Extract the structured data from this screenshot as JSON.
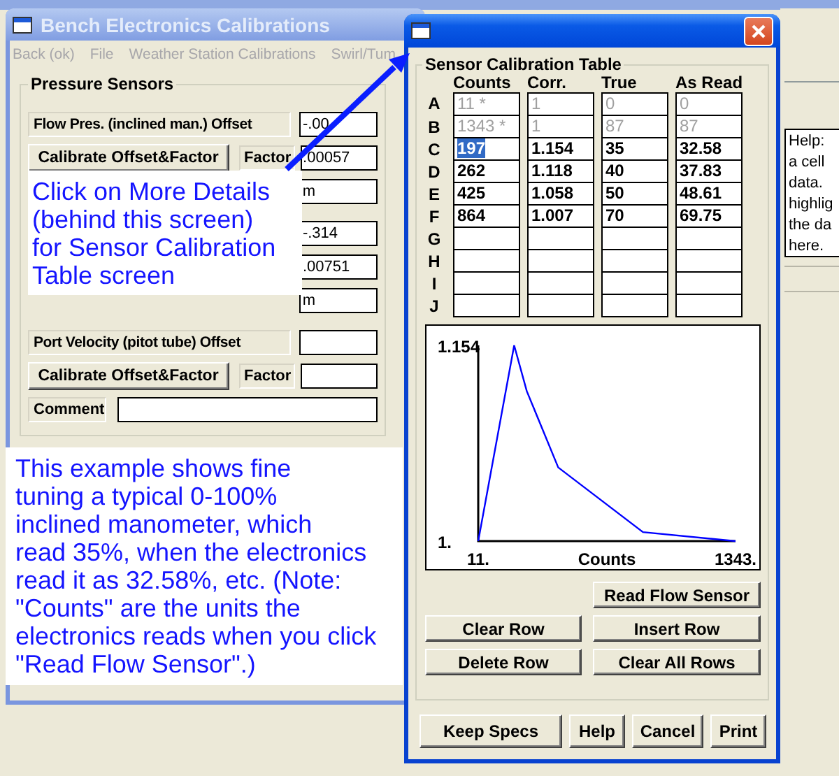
{
  "background_window": {
    "help_lines": [
      "Help:",
      "a cell",
      "data.",
      "highlig",
      "the da",
      "here."
    ]
  },
  "main_window": {
    "title": "Bench Electronics Calibrations",
    "menu": [
      {
        "label": "Back (ok)",
        "disabled": true
      },
      {
        "label": "File",
        "disabled": true
      },
      {
        "label": "Weather Station Calibrations",
        "disabled": true
      },
      {
        "label": "Swirl/Tum",
        "disabled": true
      }
    ],
    "group": {
      "title": "Pressure Sensors",
      "sensors": [
        {
          "label": "Flow Pres. (inclined man.) Offset",
          "offset": "-.00",
          "button": "Calibrate Offset&Factor",
          "factor_label": "Factor",
          "factor": ".00057",
          "comment": "m"
        },
        {
          "offset": "-.314",
          "factor": ".00751",
          "comment": "m"
        },
        {
          "label": "Port Velocity (pitot tube) Offset",
          "button": "Calibrate Offset&Factor",
          "factor_label": "Factor",
          "comment_label": "Comment"
        }
      ]
    }
  },
  "dialog": {
    "group_title": "Sensor Calibration Table",
    "columns": [
      "Counts",
      "Corr.",
      "True",
      "As Read"
    ],
    "rows": [
      {
        "label": "A",
        "disabled": true,
        "cells": [
          {
            "text": "11 *",
            "selected": false
          },
          {
            "text": "1",
            "selected": false
          },
          {
            "text": "0",
            "selected": false
          },
          {
            "text": "0",
            "selected": false
          }
        ]
      },
      {
        "label": "B",
        "disabled": true,
        "cells": [
          {
            "text": "1343 *",
            "selected": false
          },
          {
            "text": "1",
            "selected": false
          },
          {
            "text": "87",
            "selected": false
          },
          {
            "text": "87",
            "selected": false
          }
        ]
      },
      {
        "label": "C",
        "disabled": false,
        "cells": [
          {
            "text": "197",
            "selected": true
          },
          {
            "text": "1.154",
            "selected": false
          },
          {
            "text": "35",
            "selected": false
          },
          {
            "text": "32.58",
            "selected": false
          }
        ]
      },
      {
        "label": "D",
        "disabled": false,
        "cells": [
          {
            "text": "262",
            "selected": false
          },
          {
            "text": "1.118",
            "selected": false
          },
          {
            "text": "40",
            "selected": false
          },
          {
            "text": "37.83",
            "selected": false
          }
        ]
      },
      {
        "label": "E",
        "disabled": false,
        "cells": [
          {
            "text": "425",
            "selected": false
          },
          {
            "text": "1.058",
            "selected": false
          },
          {
            "text": "50",
            "selected": false
          },
          {
            "text": "48.61",
            "selected": false
          }
        ]
      },
      {
        "label": "F",
        "disabled": false,
        "cells": [
          {
            "text": "864",
            "selected": false
          },
          {
            "text": "1.007",
            "selected": false
          },
          {
            "text": "70",
            "selected": false
          },
          {
            "text": "69.75",
            "selected": false
          }
        ]
      },
      {
        "label": "G"
      },
      {
        "label": "H"
      },
      {
        "label": "I"
      },
      {
        "label": "J"
      }
    ],
    "chart_data": {
      "type": "line",
      "xlabel": "Counts",
      "x": [
        11,
        197,
        262,
        425,
        864,
        1343
      ],
      "series": [
        {
          "color": "#0000ff",
          "values": [
            1,
            1.154,
            1.118,
            1.058,
            1.007,
            1
          ]
        }
      ],
      "xlim": [
        11,
        1343
      ],
      "ylim": [
        1,
        1.154
      ],
      "xticks": [
        {
          "value": 11,
          "label": "11."
        },
        {
          "value": 1343,
          "label": "1343."
        }
      ],
      "yticks": [
        {
          "value": 1,
          "label": "1."
        },
        {
          "value": 1.154,
          "label": "1.154"
        }
      ]
    },
    "table_buttons": [
      "Read Flow Sensor",
      "Clear Row",
      "Insert Row",
      "Delete Row",
      "Clear All Rows"
    ],
    "buttons": [
      "Keep Specs",
      "Help",
      "Cancel",
      "Print"
    ]
  },
  "callouts": [
    {
      "lines": [
        "Click on More Details",
        "(behind this screen)",
        "for Sensor Calibration",
        "Table screen"
      ]
    },
    {
      "lines": [
        "This example shows fine",
        "tuning a typical 0-100%",
        "inclined manometer, which",
        "read 35%, when the electronics",
        "read it as 32.58%, etc.  (Note:",
        "\"Counts\" are the units the",
        "electronics reads when you click",
        "\"Read Flow Sensor\".)"
      ]
    }
  ]
}
